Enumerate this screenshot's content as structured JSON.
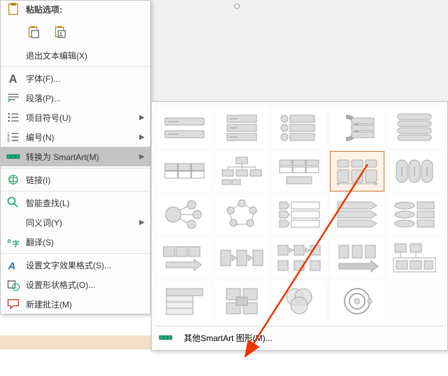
{
  "paste_header": "粘贴选项:",
  "menu": {
    "exit_text_edit": "退出文本编辑(X)",
    "font": "字体(F)...",
    "paragraph": "段落(P)...",
    "bullets": "项目符号(U)",
    "numbering": "编号(N)",
    "convert_smartart": "转换为 SmartArt(M)",
    "link": "链接(I)",
    "smart_lookup": "智能查找(L)",
    "synonyms": "同义词(Y)",
    "translate": "翻译(S)",
    "format_text_effects": "设置文字效果格式(S)...",
    "format_shape": "设置形状格式(O)...",
    "new_comment": "新建批注(M)"
  },
  "submenu": {
    "more_smartart": "其他SmartArt 图形(M)..."
  }
}
